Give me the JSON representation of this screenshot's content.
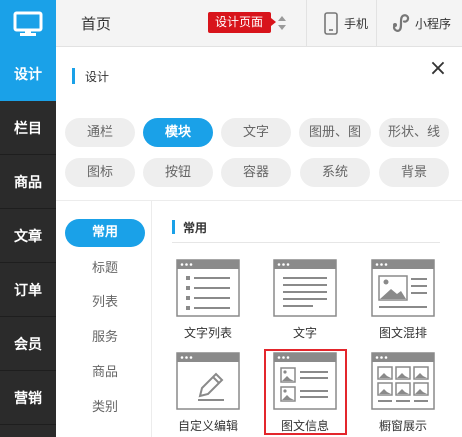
{
  "nav": {
    "items": [
      "设计",
      "栏目",
      "商品",
      "文章",
      "订单",
      "会员",
      "营销"
    ],
    "active_index": 0
  },
  "topbar": {
    "home": "首页",
    "page_badge": "设计页面",
    "phone": "手机",
    "miniprogram": "小程序"
  },
  "panel": {
    "title": "设计",
    "close": "×"
  },
  "categories": [
    "通栏",
    "模块",
    "文字",
    "图册、图",
    "形状、线",
    "图标",
    "按钮",
    "容器",
    "系统",
    "背景"
  ],
  "active_category": "模块",
  "sub_categories": [
    "常用",
    "标题",
    "列表",
    "服务",
    "商品",
    "类别"
  ],
  "active_sub_category": "常用",
  "section": {
    "title": "常用",
    "tiles": [
      "文字列表",
      "文字",
      "图文混排",
      "自定义编辑",
      "图文信息",
      "橱窗展示"
    ]
  },
  "colors": {
    "accent": "#1aa1e8",
    "badge": "#d8141b",
    "highlight": "#e3262c",
    "nav_bg": "#2b2b2b"
  }
}
